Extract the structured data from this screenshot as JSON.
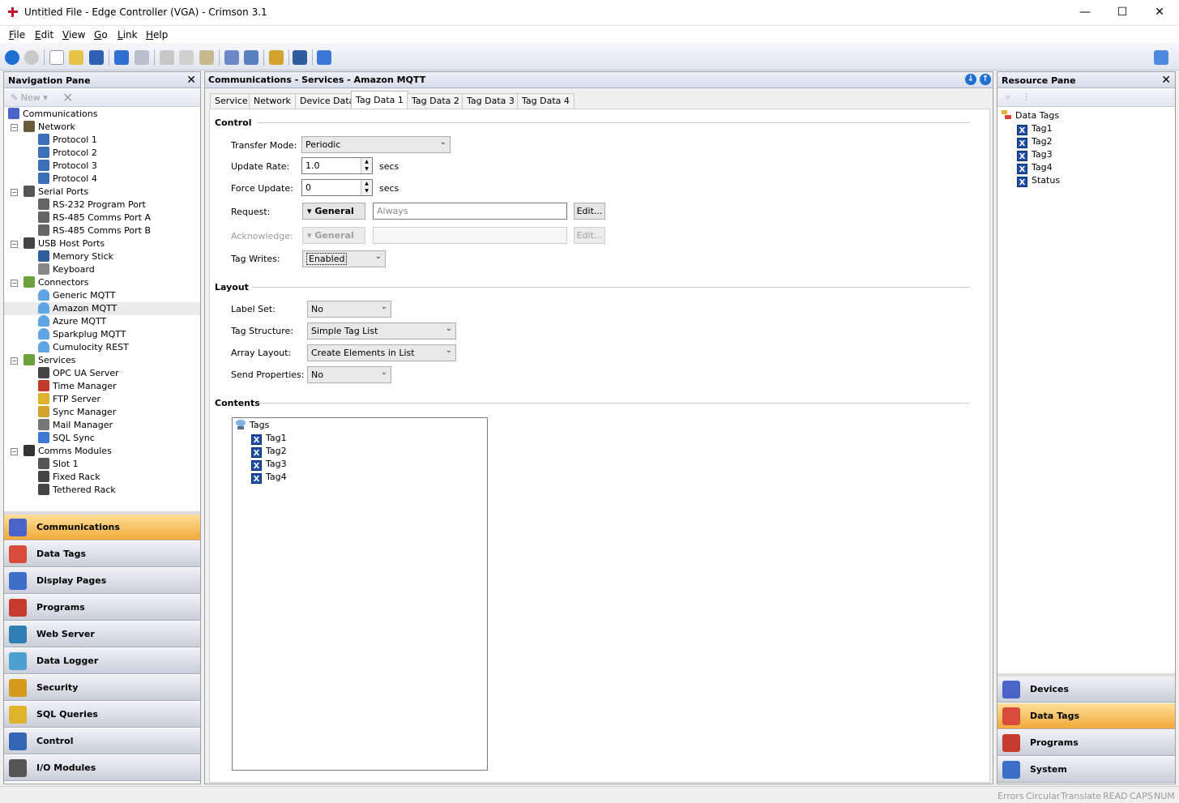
{
  "window": {
    "title": "Untitled File - Edge Controller (VGA) - Crimson 3.1",
    "controls": {
      "minimize": "—",
      "maximize": "☐",
      "close": "✕"
    }
  },
  "menu": [
    {
      "label": "File",
      "u": "F",
      "rest": "ile"
    },
    {
      "label": "Edit",
      "u": "E",
      "rest": "dit"
    },
    {
      "label": "View",
      "u": "V",
      "rest": "iew"
    },
    {
      "label": "Go",
      "u": "G",
      "rest": "o"
    },
    {
      "label": "Link",
      "u": "L",
      "rest": "ink"
    },
    {
      "label": "Help",
      "u": "H",
      "rest": "elp"
    }
  ],
  "nav_pane": {
    "title": "Navigation Pane",
    "new_label": "New",
    "tree": [
      {
        "label": "Communications",
        "level": 0,
        "icon": "comms-icon"
      },
      {
        "label": "Network",
        "level": 1,
        "icon": "network-icon",
        "expander": "⊟"
      },
      {
        "label": "Protocol 1",
        "level": 2,
        "icon": "protocol-icon"
      },
      {
        "label": "Protocol 2",
        "level": 2,
        "icon": "protocol-icon"
      },
      {
        "label": "Protocol 3",
        "level": 2,
        "icon": "protocol-icon"
      },
      {
        "label": "Protocol 4",
        "level": 2,
        "icon": "protocol-icon"
      },
      {
        "label": "Serial Ports",
        "level": 1,
        "icon": "serial-icon",
        "expander": "⊟"
      },
      {
        "label": "RS-232 Program Port",
        "level": 2,
        "icon": "port-icon"
      },
      {
        "label": "RS-485 Comms Port A",
        "level": 2,
        "icon": "port-icon"
      },
      {
        "label": "RS-485 Comms Port B",
        "level": 2,
        "icon": "port-icon"
      },
      {
        "label": "USB Host Ports",
        "level": 1,
        "icon": "usb-icon",
        "expander": "⊟"
      },
      {
        "label": "Memory Stick",
        "level": 2,
        "icon": "memory-stick-icon"
      },
      {
        "label": "Keyboard",
        "level": 2,
        "icon": "keyboard-icon"
      },
      {
        "label": "Connectors",
        "level": 1,
        "icon": "connectors-icon",
        "expander": "⊟"
      },
      {
        "label": "Generic MQTT",
        "level": 2,
        "icon": "cloud-icon"
      },
      {
        "label": "Amazon MQTT",
        "level": 2,
        "icon": "cloud-icon",
        "selected": true
      },
      {
        "label": "Azure MQTT",
        "level": 2,
        "icon": "cloud-icon"
      },
      {
        "label": "Sparkplug MQTT",
        "level": 2,
        "icon": "cloud-icon"
      },
      {
        "label": "Cumulocity REST",
        "level": 2,
        "icon": "cloud-icon"
      },
      {
        "label": "Services",
        "level": 1,
        "icon": "services-icon",
        "expander": "⊟"
      },
      {
        "label": "OPC UA Server",
        "level": 2,
        "icon": "opcua-icon"
      },
      {
        "label": "Time Manager",
        "level": 2,
        "icon": "clock-icon"
      },
      {
        "label": "FTP Server",
        "level": 2,
        "icon": "ftp-icon"
      },
      {
        "label": "Sync Manager",
        "level": 2,
        "icon": "sync-icon"
      },
      {
        "label": "Mail Manager",
        "level": 2,
        "icon": "mail-icon"
      },
      {
        "label": "SQL Sync",
        "level": 2,
        "icon": "sql-icon"
      },
      {
        "label": "Comms Modules",
        "level": 1,
        "icon": "module-icon",
        "expander": "⊟"
      },
      {
        "label": "Slot 1",
        "level": 2,
        "icon": "slot-icon"
      },
      {
        "label": "Fixed Rack",
        "level": 2,
        "icon": "rack-icon"
      },
      {
        "label": "Tethered Rack",
        "level": 2,
        "icon": "rack-icon"
      }
    ],
    "categories": [
      {
        "label": "Communications",
        "icon": "communications-icon",
        "active": true,
        "color": "#4a63c9"
      },
      {
        "label": "Data Tags",
        "icon": "data-tags-icon",
        "color": "#d94b3b"
      },
      {
        "label": "Display Pages",
        "icon": "display-pages-icon",
        "color": "#3e6fc8"
      },
      {
        "label": "Programs",
        "icon": "programs-icon",
        "color": "#c53b2f"
      },
      {
        "label": "Web Server",
        "icon": "web-server-icon",
        "color": "#2f7fb5"
      },
      {
        "label": "Data Logger",
        "icon": "data-logger-icon",
        "color": "#4da1cf"
      },
      {
        "label": "Security",
        "icon": "security-icon",
        "color": "#d49a1c"
      },
      {
        "label": "SQL Queries",
        "icon": "sql-queries-icon",
        "color": "#e0b12a"
      },
      {
        "label": "Control",
        "icon": "control-icon",
        "color": "#3466b3"
      },
      {
        "label": "I/O Modules",
        "icon": "io-modules-icon",
        "color": "#555555"
      }
    ]
  },
  "center": {
    "header": "Communications - Services - Amazon MQTT",
    "tabs": [
      "Service",
      "Network",
      "Device Data",
      "Tag Data 1",
      "Tag Data 2",
      "Tag Data 3",
      "Tag Data 4"
    ],
    "active_tab": "Tag Data 1",
    "control": {
      "section": "Control",
      "transfer_mode_label": "Transfer Mode:",
      "transfer_mode_value": "Periodic",
      "update_rate_label": "Update Rate:",
      "update_rate_value": "1.0",
      "update_rate_unit": "secs",
      "force_update_label": "Force Update:",
      "force_update_value": "0",
      "force_update_unit": "secs",
      "request_label": "Request:",
      "request_mode": "General",
      "request_value": "Always",
      "request_edit": "Edit...",
      "ack_label": "Acknowledge:",
      "ack_mode": "General",
      "ack_value": "",
      "ack_edit": "Edit...",
      "tag_writes_label": "Tag Writes:",
      "tag_writes_value": "Enabled"
    },
    "layout": {
      "section": "Layout",
      "label_set_label": "Label Set:",
      "label_set_value": "No",
      "tag_structure_label": "Tag Structure:",
      "tag_structure_value": "Simple Tag List",
      "array_layout_label": "Array Layout:",
      "array_layout_value": "Create Elements in List",
      "send_props_label": "Send Properties:",
      "send_props_value": "No"
    },
    "contents": {
      "section": "Contents",
      "root": "Tags",
      "items": [
        "Tag1",
        "Tag2",
        "Tag3",
        "Tag4"
      ]
    }
  },
  "resource_pane": {
    "title": "Resource Pane",
    "root": "Data Tags",
    "items": [
      "Tag1",
      "Tag2",
      "Tag3",
      "Tag4",
      "Status"
    ],
    "categories": [
      {
        "label": "Devices",
        "icon": "devices-icon",
        "color": "#4a63c9"
      },
      {
        "label": "Data Tags",
        "icon": "data-tags-icon",
        "active": true,
        "color": "#d94b3b"
      },
      {
        "label": "Programs",
        "icon": "programs-icon",
        "color": "#c53b2f"
      },
      {
        "label": "System",
        "icon": "system-icon",
        "color": "#3e6fc8"
      }
    ]
  },
  "status": [
    "Errors",
    "Circular",
    "Translate",
    "READ",
    "CAPS",
    "NUM"
  ]
}
